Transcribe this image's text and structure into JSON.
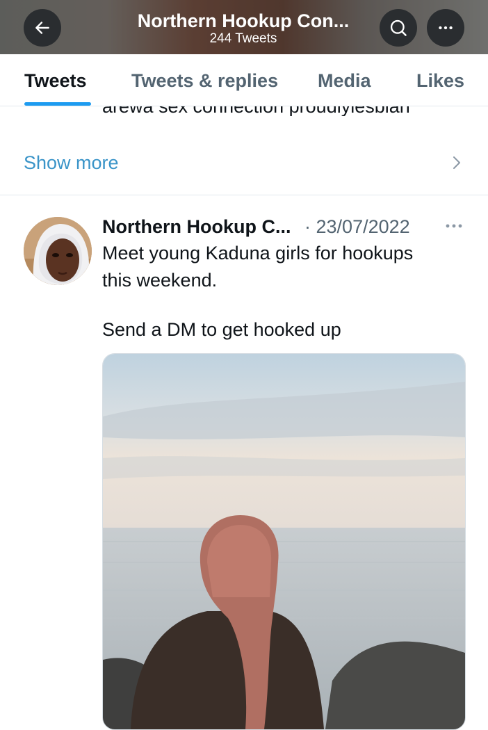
{
  "header": {
    "title": "Northern Hookup Con...",
    "subtitle": "244 Tweets",
    "back_icon": "arrow-left-icon",
    "search_icon": "search-icon",
    "more_icon": "more-horizontal-icon"
  },
  "tabs": [
    {
      "label": "Tweets",
      "active": true
    },
    {
      "label": "Tweets & replies",
      "active": false
    },
    {
      "label": "Media",
      "active": false
    },
    {
      "label": "Likes",
      "active": false
    }
  ],
  "previous_tweet": {
    "clipped_text": "arewa sex connection proudlylesbian",
    "show_more_label": "Show more"
  },
  "tweet": {
    "author": "Northern Hookup C...",
    "separator": "·",
    "date": "23/07/2022",
    "line1": "Meet young Kaduna girls for hookups",
    "line2": "this weekend.",
    "line3": "Send a DM to get hooked up"
  },
  "colors": {
    "accent": "#1d9bf0",
    "link": "#3a94c8",
    "muted": "#536471",
    "text": "#0f1419"
  }
}
